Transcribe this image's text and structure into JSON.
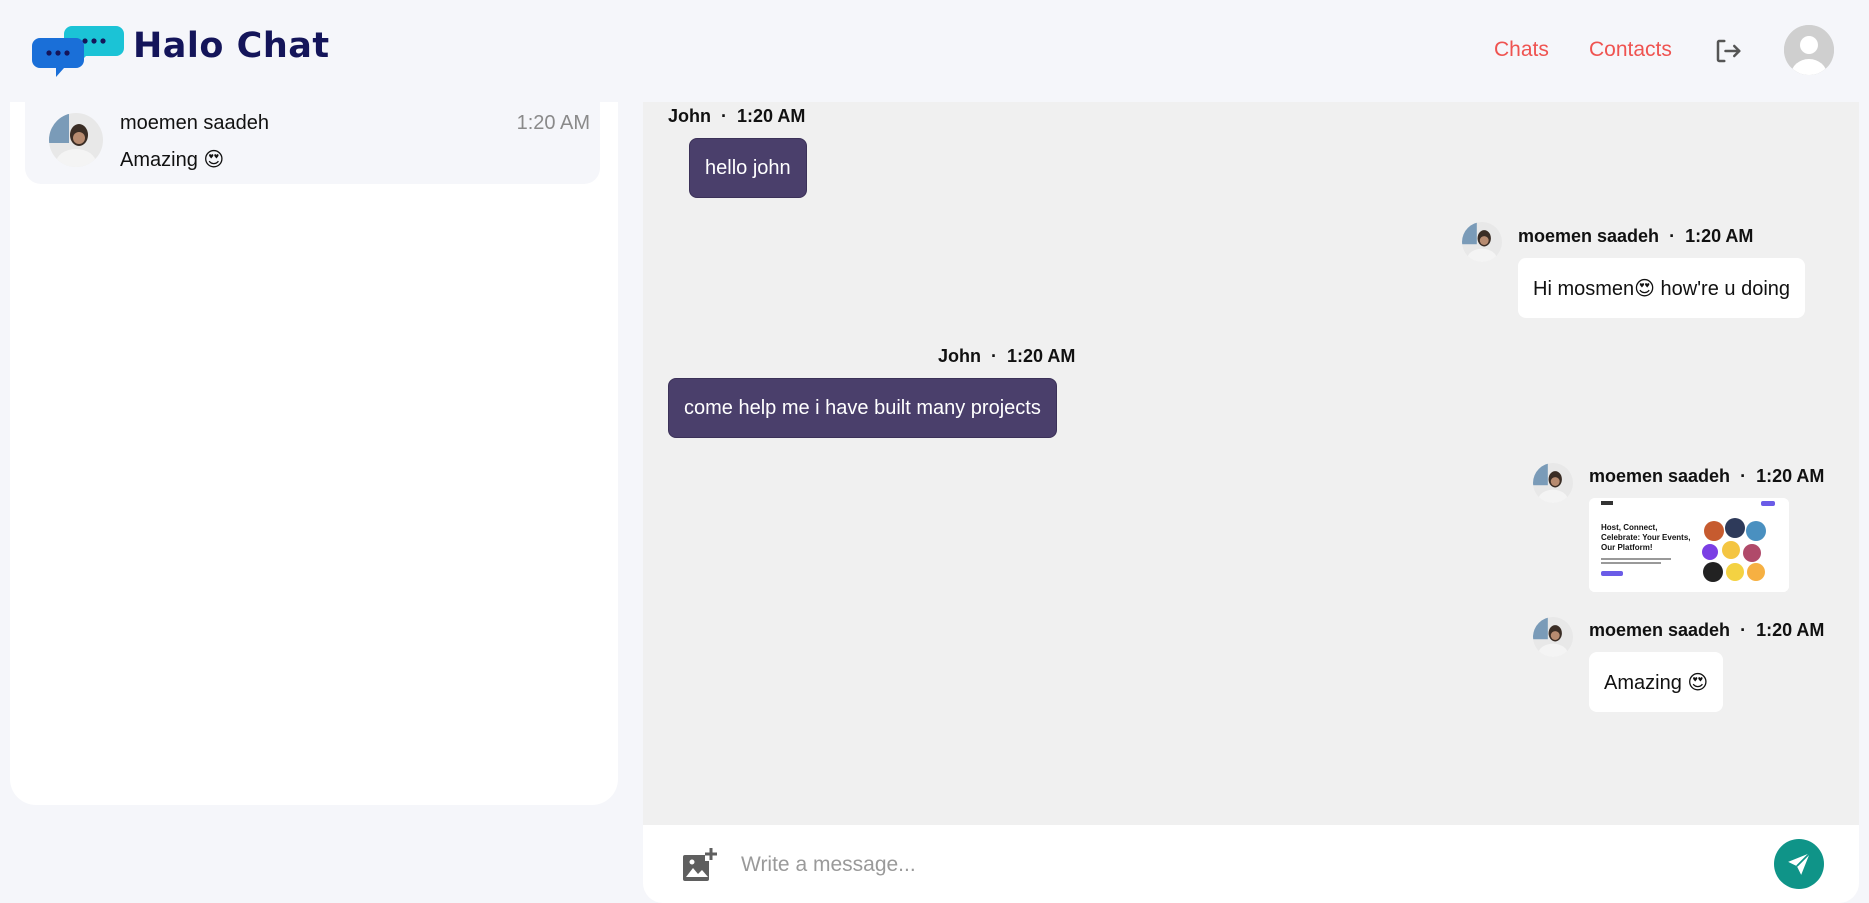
{
  "app": {
    "title": "Halo Chat"
  },
  "nav": {
    "chats": "Chats",
    "contacts": "Contacts"
  },
  "icons": {
    "logo": "chat-bubbles-icon",
    "logout": "logout-icon",
    "user": "user-avatar-icon",
    "attach": "add-image-icon",
    "send": "send-icon"
  },
  "colors": {
    "brand": "#14155a",
    "nav": "#ef5350",
    "outgoing": "#4a3f6b",
    "send": "#0f9488"
  },
  "sidebar": {
    "conversations": [
      {
        "name": "moemen saadeh",
        "time": "1:20 AM",
        "preview": "Amazing 😍"
      }
    ]
  },
  "messages": [
    {
      "sender": "John",
      "time": "1:20 AM",
      "text": "hello john"
    },
    {
      "sender": "moemen saadeh",
      "time": "1:20 AM",
      "text": "Hi mosmen😍 how're u doing"
    },
    {
      "sender": "John",
      "time": "1:20 AM",
      "text": "come help me i have built many projects"
    },
    {
      "sender": "moemen saadeh",
      "time": "1:20 AM",
      "image": {
        "heading": "Host, Connect, Celebrate: Your Events, Our Platform!"
      }
    },
    {
      "sender": "moemen saadeh",
      "time": "1:20 AM",
      "text": "Amazing 😍"
    }
  ],
  "composer": {
    "placeholder": "Write a message..."
  }
}
